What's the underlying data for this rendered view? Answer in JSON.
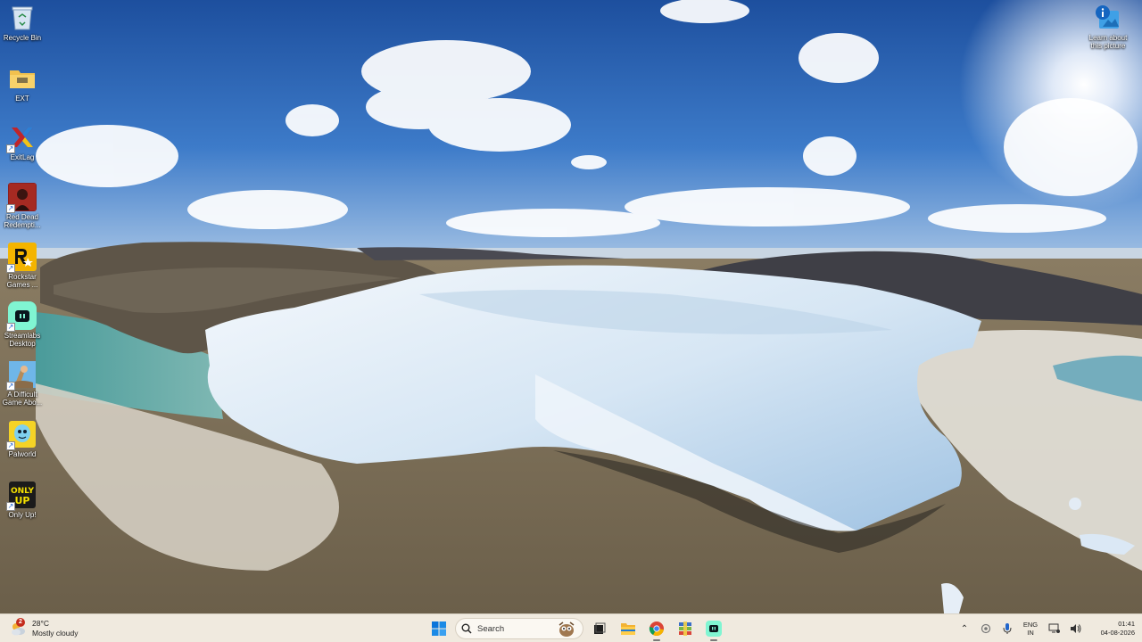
{
  "desktop": {
    "icons": [
      {
        "label": "Recycle Bin"
      },
      {
        "label": "EXT"
      },
      {
        "label": "ExitLag"
      },
      {
        "label": "Red Dead\nRedempti..."
      },
      {
        "label": "Rockstar\nGames ..."
      },
      {
        "label": "Streamlabs\nDesktop"
      },
      {
        "label": "A Difficult\nGame Abo..."
      },
      {
        "label": "Palworld"
      },
      {
        "label": "Only Up!"
      }
    ],
    "learn_label": "Learn about\nthis picture"
  },
  "taskbar": {
    "weather": {
      "temp": "28°C",
      "condition": "Mostly cloudy",
      "badge": "2"
    },
    "search": {
      "placeholder": "Search"
    },
    "tray": {
      "lang_top": "ENG",
      "lang_bottom": "IN",
      "time": "01:41",
      "date": "04-08-2026"
    }
  },
  "colors": {
    "accent": "#0067c0",
    "taskbar_bg": "#f0eadf"
  }
}
